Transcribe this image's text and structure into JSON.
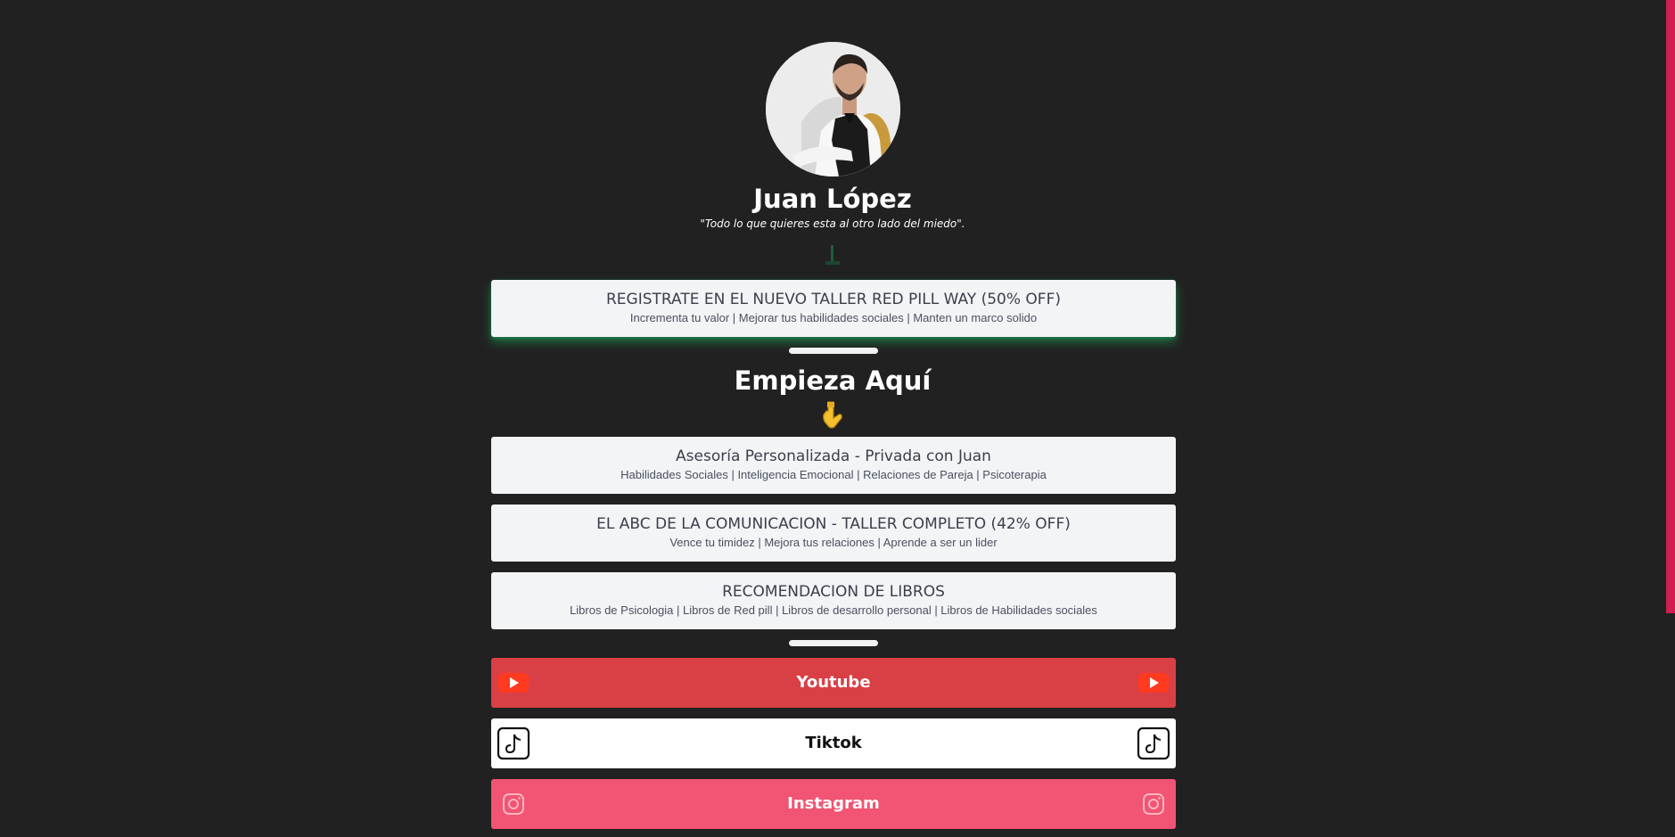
{
  "profile": {
    "name": "Juan López",
    "quote": "\"Todo lo que quieres esta al otro lado del miedo\"."
  },
  "featured_link": {
    "title": "REGISTRATE EN EL NUEVO TALLER RED PILL WAY (50% OFF)",
    "subtitle": "Incrementa tu valor | Mejorar tus habilidades sociales | Manten un marco solido"
  },
  "section": {
    "heading": "Empieza Aquí"
  },
  "links": [
    {
      "title": "Asesoría Personalizada - Privada con Juan",
      "subtitle": "Habilidades Sociales | Inteligencia Emocional | Relaciones de Pareja | Psicoterapia"
    },
    {
      "title": "EL ABC DE LA COMUNICACION - TALLER COMPLETO (42% OFF)",
      "subtitle": "Vence tu timidez | Mejora tus relaciones | Aprende a ser un lider"
    },
    {
      "title": "RECOMENDACION DE LIBROS",
      "subtitle": "Libros de Psicologia | Libros de Red pill | Libros de desarrollo personal | Libros de Habilidades sociales"
    }
  ],
  "social": [
    {
      "label": "Youtube",
      "icon": "youtube-icon",
      "color": "#d94045"
    },
    {
      "label": "Tiktok",
      "icon": "tiktok-icon",
      "color": "#ffffff"
    },
    {
      "label": "Instagram",
      "icon": "instagram-icon",
      "color": "#f25473"
    }
  ],
  "colors": {
    "background": "#212121",
    "card": "#f2f4f6",
    "accent_glow": "#19aa5a",
    "scrollbar": "#cf1e4f"
  }
}
